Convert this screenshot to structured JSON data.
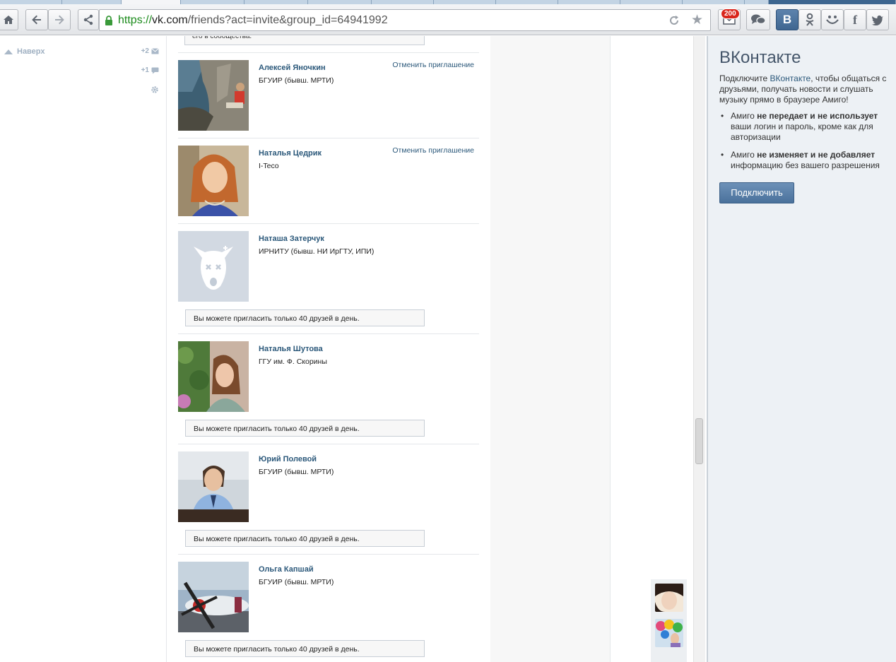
{
  "browser": {
    "url_scheme": "https://",
    "url_host": "vk.com",
    "url_path": "/friends?act=invite&group_id=64941992",
    "notifications_badge": "200"
  },
  "toolbar_icons": [
    "home-icon",
    "back-icon",
    "forward-icon",
    "share-icon",
    "lock-icon",
    "reload-icon",
    "star-icon",
    "mail-icon",
    "chat-icon",
    "vk-icon",
    "odnoklassniki-icon",
    "moi-mir-icon",
    "facebook-icon",
    "twitter-icon"
  ],
  "leftcol": {
    "up_label": "Наверх",
    "counter_messages": "+2",
    "counter_comments": "+1"
  },
  "top_note": "его в сообщества.",
  "friends": [
    {
      "name": "Алексей Яночкин",
      "sub": "БГУИР (бывш. МРТИ)",
      "action": "Отменить приглашение",
      "limit": ""
    },
    {
      "name": "Наталья Цедрик",
      "sub": "I-Teco",
      "action": "Отменить приглашение",
      "limit": ""
    },
    {
      "name": "Наташа Затерчук",
      "sub": "ИРНИТУ (бывш. НИ ИрГТУ, ИПИ)",
      "action": "",
      "limit": "Вы можете пригласить только 40 друзей в день."
    },
    {
      "name": "Наталья Шутова",
      "sub": "ГГУ им. Ф. Скорины",
      "action": "",
      "limit": "Вы можете пригласить только 40 друзей в день."
    },
    {
      "name": "Юрий Полевой",
      "sub": "БГУИР (бывш. МРТИ)",
      "action": "",
      "limit": "Вы можете пригласить только 40 друзей в день."
    },
    {
      "name": "Ольга Капшай",
      "sub": "БГУИР (бывш. МРТИ)",
      "action": "",
      "limit": "Вы можете пригласить только 40 друзей в день."
    }
  ],
  "amigo": {
    "title": "ВКонтакте",
    "intro_before": "Подключите ",
    "intro_link": "ВКонтакте",
    "intro_after": ", чтобы общаться с друзьями, получать новости и слушать музыку прямо в браузере Амиго!",
    "bullet1_a": "Амиго ",
    "bullet1_b": "не передает и не использует",
    "bullet1_c": " ваши логин и пароль, кроме как для авторизации",
    "bullet2_a": "Амиго ",
    "bullet2_b": "не изменяет и не добавляет",
    "bullet2_c": " информацию без вашего разрешения",
    "connect_label": "Подключить"
  },
  "colors": {
    "vk_blue": "#2b587a",
    "badge_red": "#d9261c",
    "button_blue": "#5a7fa8"
  }
}
